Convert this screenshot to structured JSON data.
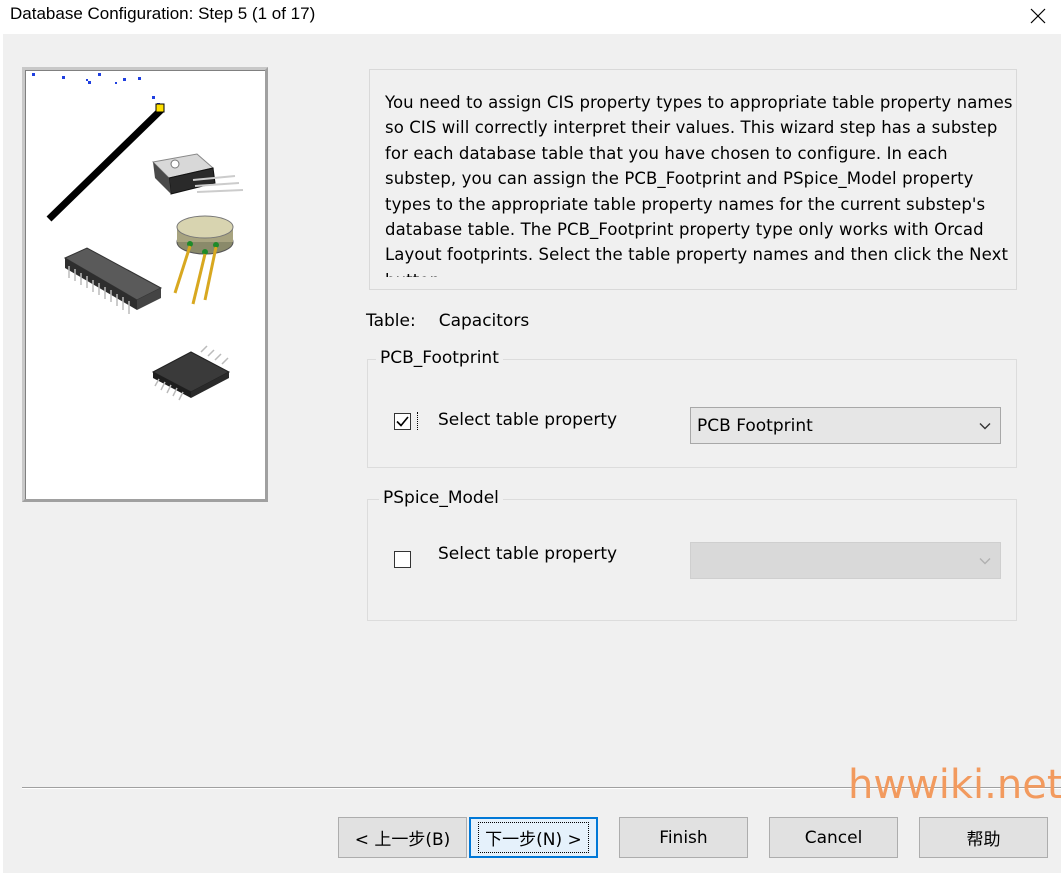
{
  "window": {
    "title": "Database Configuration: Step 5 (1 of 17)"
  },
  "description": "You need to assign CIS property types to appropriate table property names so CIS will correctly interpret their values. This wizard step has a substep for each database table that you have chosen to configure. In each substep, you can assign the PCB_Footprint and PSpice_Model property types to the appropriate table property names for the current substep's database table. The PCB_Footprint property type only works with Orcad Layout footprints. Select the table property names and then click the Next button.",
  "table": {
    "label": "Table:",
    "value": "Capacitors"
  },
  "pcb_group": {
    "legend": "PCB_Footprint",
    "checkbox_checked": true,
    "label": "Select table property",
    "selected": "PCB Footprint"
  },
  "pspice_group": {
    "legend": "PSpice_Model",
    "checkbox_checked": false,
    "label": "Select table property",
    "selected": ""
  },
  "buttons": {
    "back": "< 上一步(B)",
    "next": "下一步(N) >",
    "finish": "Finish",
    "cancel": "Cancel",
    "help": "帮助"
  },
  "watermark": "hwwiki.net",
  "icons": {
    "close": "close-icon",
    "chevron": "chevron-down-icon",
    "check": "check-icon"
  },
  "colors": {
    "accent": "#0078d7",
    "watermark": "#f29a5e",
    "background": "#f0f0f0"
  }
}
